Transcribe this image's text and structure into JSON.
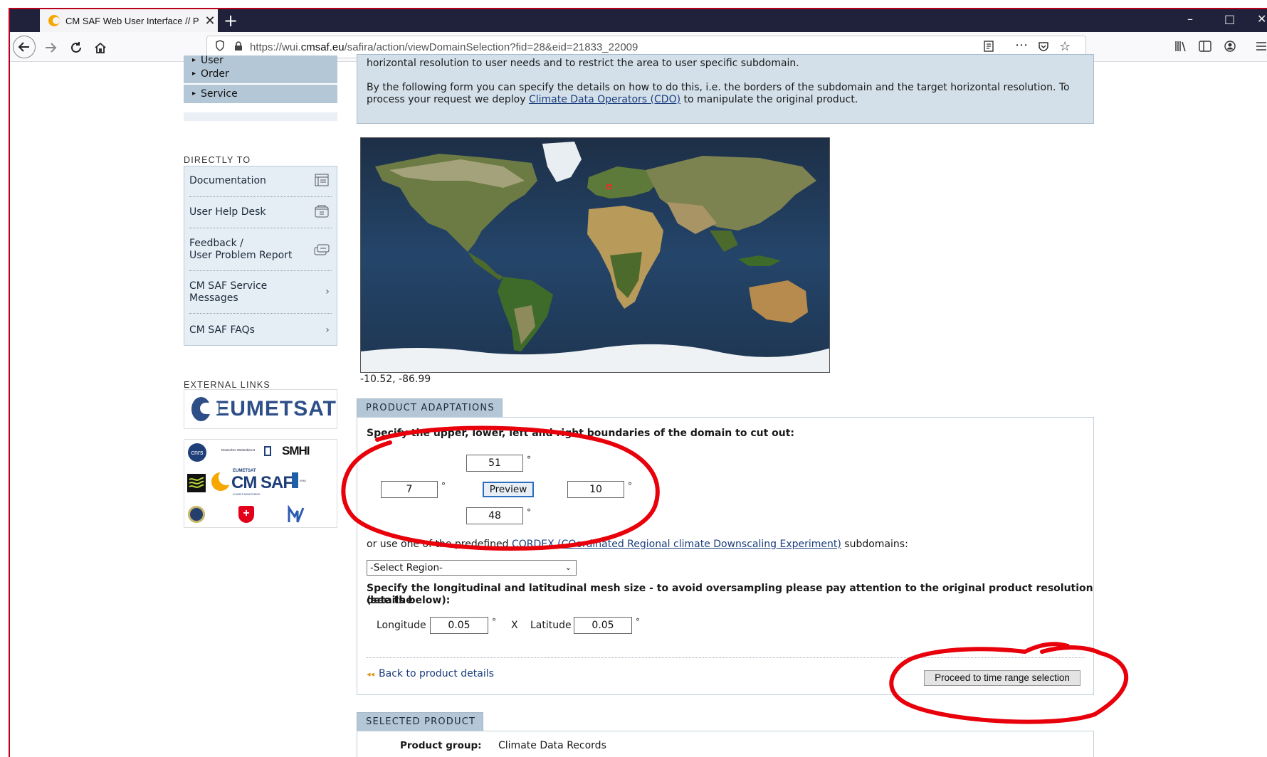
{
  "browser": {
    "tab_title": "CM SAF Web User Interface // P",
    "tab_close": "✕",
    "new_tab": "+",
    "url_prefix": "https://wui.",
    "url_domain": "cmsaf.eu",
    "url_path": "/safira/action/viewDomainSelection?fid=28&eid=21833_22009"
  },
  "sidebar": {
    "menu": [
      "User",
      "Order",
      "Service"
    ],
    "directly_to_label": "DIRECTLY TO",
    "directly_to": [
      {
        "label": "Documentation",
        "icon": "document-icon"
      },
      {
        "label": "User Help Desk",
        "icon": "helpdesk-icon"
      },
      {
        "label": "Feedback /",
        "label2": "User Problem Report",
        "icon": "feedback-icon"
      },
      {
        "label": "CM SAF Service",
        "label2": "Messages",
        "icon": "chevron-right-icon"
      },
      {
        "label": "CM SAF FAQs",
        "icon": "chevron-right-icon"
      }
    ],
    "chevron": "›",
    "external_links_label": "EXTERNAL LINKS",
    "eumetsat_logo_text": "EUMETSAT",
    "partner_logos": {
      "smhi": "SMHI",
      "cmsaf": "CM SAF",
      "cmsaf_top": "EUMETSAT",
      "cmsaf_sub": "CLIMATE MONITORING",
      "rmi": "RMI",
      "metoffice": "Met Office",
      "dwd": "Deutscher Wetterdienst",
      "knmi": "KNMI",
      "cnrs": "cnrs"
    }
  },
  "intro": {
    "line1": "horizontal resolution to user needs and to restrict the area to user specific subdomain.",
    "line2_a": "By the following form you can specify the details on how to do this, i.e. the borders of the subdomain and the target horizontal resolution. To",
    "line3_a": "process your request we deploy ",
    "line3_link": "Climate Data Operators (CDO)",
    "line3_b": " to manipulate the original product."
  },
  "map": {
    "coords": "-10.52, -86.99"
  },
  "adaptations": {
    "tab_label": "PRODUCT ADAPTATIONS",
    "instruction": "Specify the upper, lower, left and right boundaries of the domain to cut out:",
    "upper": "51",
    "lower": "48",
    "left": "7",
    "right": "10",
    "degree": "°",
    "preview_label": "Preview",
    "predefined_a": "or use one of the predefined ",
    "predefined_link_short": "CORDEX",
    "predefined_link_long": "(COordinated Regional climate Downscaling Experiment)",
    "predefined_b": " subdomains:",
    "select_region": "-Select Region-",
    "mesh_instruction_1": "Specify the longitudinal and latitudinal mesh size - to avoid oversampling please pay attention to the original product resolution (see the",
    "mesh_instruction_2": "details below):",
    "longitude_label": "Longitude",
    "longitude_value": "0.05",
    "x_label": "X",
    "latitude_label": "Latitude",
    "latitude_value": "0.05",
    "back_arrows": "◂◂",
    "back_link": "Back to product details",
    "proceed_label": "Proceed to time range selection"
  },
  "selected_product": {
    "tab_label": "SELECTED PRODUCT",
    "group_label": "Product group:",
    "group_value": "Climate Data Records"
  },
  "colors": {
    "menu_bg": "#b4c7d7",
    "panel_bg": "#d3e0ea",
    "annotation_red": "#e8000b",
    "link": "#1a3d7c"
  }
}
